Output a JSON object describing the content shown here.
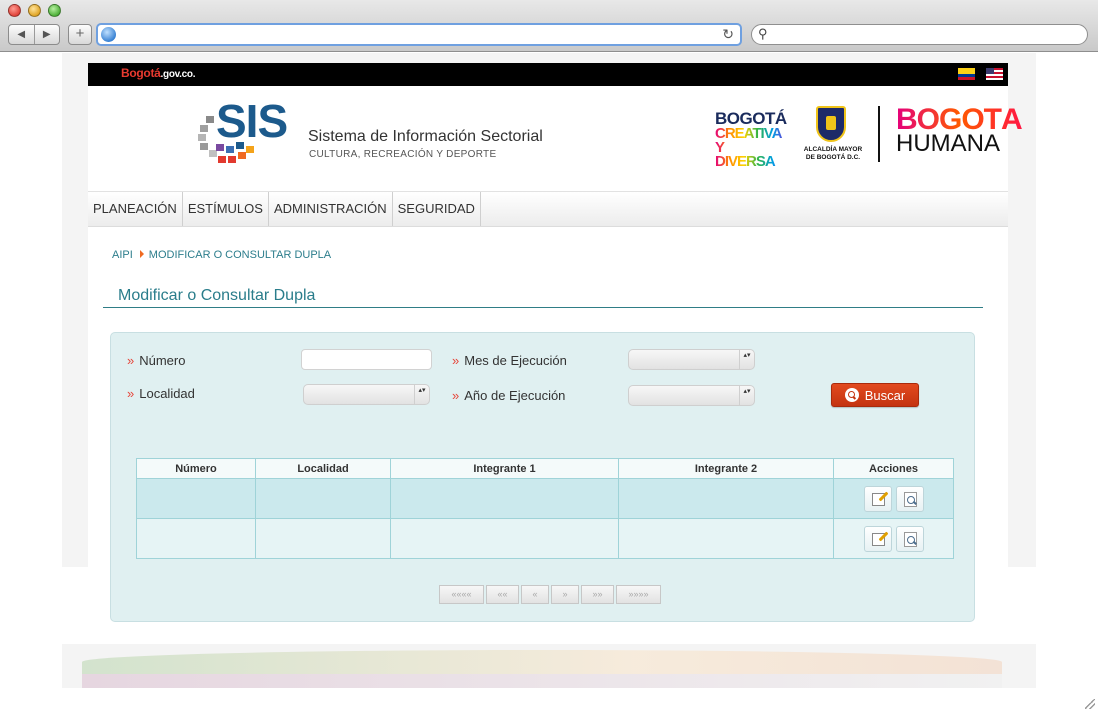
{
  "site": {
    "brand_left": "Bogotá",
    "brand_left_domain": ".gov.co.",
    "sis_logo_text": "SIS",
    "sis_title": "Sistema de Información Sectorial",
    "sis_subtitle": "CULTURA, RECREACIÓN Y DEPORTE",
    "logo_creativa_line1": "BOGOTÁ",
    "logo_creativa_line2": "CREATIVA Y",
    "logo_creativa_line3": "DIVERSA",
    "alcaldia_label": "ALCALDÍA MAYOR DE BOGOTÁ D.C.",
    "humana_line1": "BOGOTÁ",
    "humana_line2": "HUMANA"
  },
  "menu": [
    {
      "label": "PLANEACIÓN"
    },
    {
      "label": "ESTÍMULOS"
    },
    {
      "label": "ADMINISTRACIÓN"
    },
    {
      "label": "SEGURIDAD"
    }
  ],
  "breadcrumb": {
    "root": "AIPI",
    "current": "MODIFICAR O CONSULTAR DUPLA"
  },
  "page_title": "Modificar o Consultar Dupla",
  "form": {
    "numero_label": "Número",
    "numero_value": "",
    "localidad_label": "Localidad",
    "localidad_value": "",
    "mes_label": "Mes de Ejecución",
    "mes_value": "",
    "anio_label": "Año de Ejecución",
    "anio_value": "",
    "buscar_label": "Buscar"
  },
  "table": {
    "headers": [
      "Número",
      "Localidad",
      "Integrante 1",
      "Integrante 2",
      "Acciones"
    ],
    "rows": [
      [
        "",
        "",
        "",
        ""
      ],
      [
        "",
        "",
        "",
        ""
      ]
    ]
  },
  "pager": {
    "first": "««««",
    "prev_block": "««",
    "prev": "«",
    "next": "»",
    "next_block": "»»",
    "last": "»»»»"
  },
  "colors": {
    "accent_teal": "#2a7d8b",
    "panel_bg": "#e0f0f1",
    "buscar_red": "#c43310"
  }
}
